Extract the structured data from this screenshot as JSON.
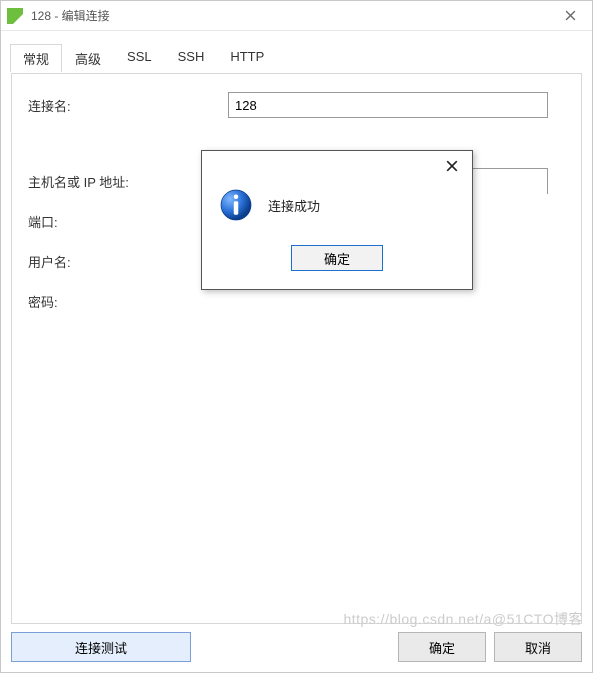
{
  "window": {
    "title": "128 - 编辑连接"
  },
  "tabs": {
    "items": [
      "常规",
      "高级",
      "SSL",
      "SSH",
      "HTTP"
    ],
    "active_index": 0
  },
  "form": {
    "connection_name_label": "连接名:",
    "connection_name_value": "128",
    "host_label": "主机名或 IP 地址:",
    "port_label": "端口:",
    "username_label": "用户名:",
    "password_label": "密码:"
  },
  "buttons": {
    "test": "连接测试",
    "ok": "确定",
    "cancel": "取消"
  },
  "modal": {
    "message": "连接成功",
    "ok": "确定"
  },
  "watermark": "https://blog.csdn.net/a@51CTO博客"
}
